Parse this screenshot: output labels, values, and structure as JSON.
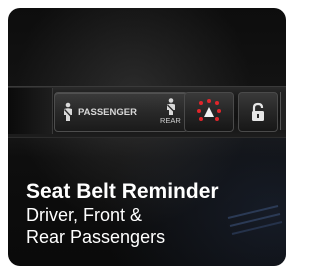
{
  "panel": {
    "passenger_label": "PASSENGER",
    "rear_label": "REAR",
    "indicator_color": "#e0262b",
    "icons": [
      "seatbelt-passenger-icon",
      "seatbelt-rear-icon",
      "hazard-icon",
      "lock-icon"
    ]
  },
  "caption": {
    "title": "Seat Belt Reminder",
    "line1": "Driver, Front &",
    "line2": "Rear Passengers"
  }
}
